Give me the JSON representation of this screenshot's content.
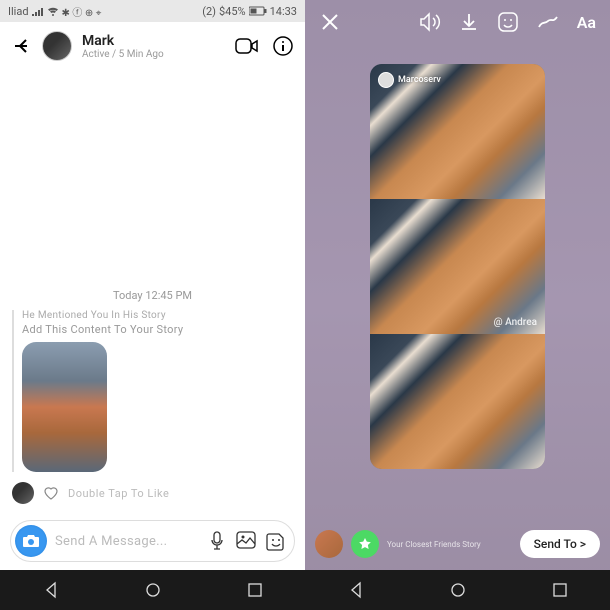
{
  "status_bar": {
    "carrier": "Iliad",
    "notifications": "(2)",
    "battery": "$45%",
    "time": "14:33"
  },
  "chat": {
    "name": "Mark",
    "active_status": "Active / 5 Min Ago",
    "timestamp": "Today 12:45 PM",
    "mention_text": "He Mentioned You In His Story",
    "mention_cta": "Add This Content To Your Story",
    "double_tap": "Double Tap To Like",
    "input_placeholder": "Send A Message..."
  },
  "story_editor": {
    "username": "Marcoserv",
    "mention_tag": "@ Andrea",
    "footer_label": "Your Closest Friends Story",
    "send_label": "Send To >"
  }
}
